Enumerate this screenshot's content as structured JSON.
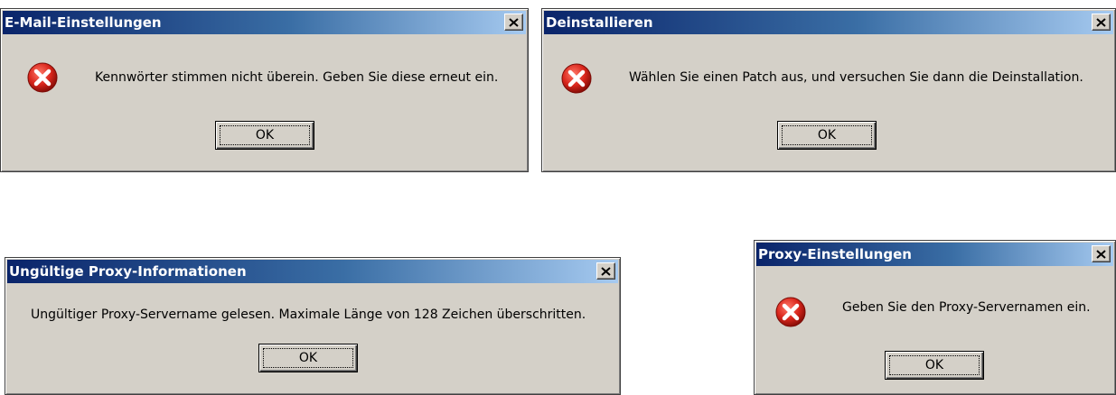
{
  "dialogs": [
    {
      "title": "E-Mail-Einstellungen",
      "message": "Kennwörter stimmen nicht überein. Geben Sie diese erneut ein.",
      "button": "OK",
      "icon": "error-icon"
    },
    {
      "title": "Deinstallieren",
      "message": "Wählen Sie einen Patch aus, und versuchen Sie dann die Deinstallation.",
      "button": "OK",
      "icon": "error-icon"
    },
    {
      "title": "Ungültige Proxy-Informationen",
      "message": "Ungültiger Proxy-Servername gelesen. Maximale Länge von 128 Zeichen überschritten.",
      "button": "OK"
    },
    {
      "title": "Proxy-Einstellungen",
      "message": "Geben Sie den Proxy-Servernamen ein.",
      "button": "OK",
      "icon": "error-icon"
    }
  ],
  "colors": {
    "dialog_face": "#d4d0c8",
    "title_start": "#0a246a",
    "title_end": "#a6caf0",
    "error_red": "#d9261c"
  }
}
